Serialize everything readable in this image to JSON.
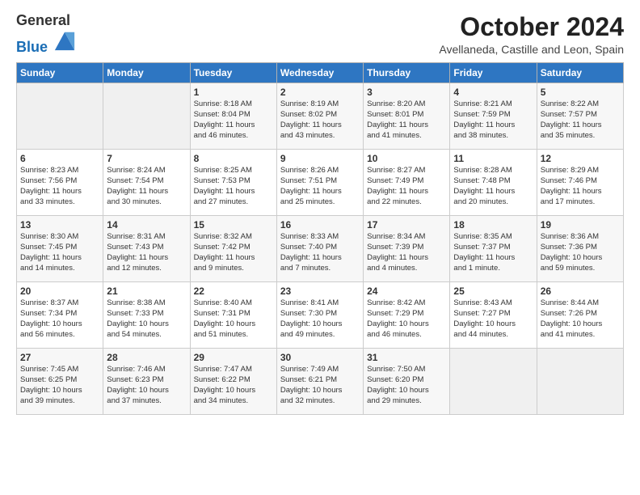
{
  "header": {
    "month_title": "October 2024",
    "subtitle": "Avellaneda, Castille and Leon, Spain",
    "logo_general": "General",
    "logo_blue": "Blue"
  },
  "calendar": {
    "headers": [
      "Sunday",
      "Monday",
      "Tuesday",
      "Wednesday",
      "Thursday",
      "Friday",
      "Saturday"
    ],
    "weeks": [
      [
        {
          "day": "",
          "detail": ""
        },
        {
          "day": "",
          "detail": ""
        },
        {
          "day": "1",
          "detail": "Sunrise: 8:18 AM\nSunset: 8:04 PM\nDaylight: 11 hours\nand 46 minutes."
        },
        {
          "day": "2",
          "detail": "Sunrise: 8:19 AM\nSunset: 8:02 PM\nDaylight: 11 hours\nand 43 minutes."
        },
        {
          "day": "3",
          "detail": "Sunrise: 8:20 AM\nSunset: 8:01 PM\nDaylight: 11 hours\nand 41 minutes."
        },
        {
          "day": "4",
          "detail": "Sunrise: 8:21 AM\nSunset: 7:59 PM\nDaylight: 11 hours\nand 38 minutes."
        },
        {
          "day": "5",
          "detail": "Sunrise: 8:22 AM\nSunset: 7:57 PM\nDaylight: 11 hours\nand 35 minutes."
        }
      ],
      [
        {
          "day": "6",
          "detail": "Sunrise: 8:23 AM\nSunset: 7:56 PM\nDaylight: 11 hours\nand 33 minutes."
        },
        {
          "day": "7",
          "detail": "Sunrise: 8:24 AM\nSunset: 7:54 PM\nDaylight: 11 hours\nand 30 minutes."
        },
        {
          "day": "8",
          "detail": "Sunrise: 8:25 AM\nSunset: 7:53 PM\nDaylight: 11 hours\nand 27 minutes."
        },
        {
          "day": "9",
          "detail": "Sunrise: 8:26 AM\nSunset: 7:51 PM\nDaylight: 11 hours\nand 25 minutes."
        },
        {
          "day": "10",
          "detail": "Sunrise: 8:27 AM\nSunset: 7:49 PM\nDaylight: 11 hours\nand 22 minutes."
        },
        {
          "day": "11",
          "detail": "Sunrise: 8:28 AM\nSunset: 7:48 PM\nDaylight: 11 hours\nand 20 minutes."
        },
        {
          "day": "12",
          "detail": "Sunrise: 8:29 AM\nSunset: 7:46 PM\nDaylight: 11 hours\nand 17 minutes."
        }
      ],
      [
        {
          "day": "13",
          "detail": "Sunrise: 8:30 AM\nSunset: 7:45 PM\nDaylight: 11 hours\nand 14 minutes."
        },
        {
          "day": "14",
          "detail": "Sunrise: 8:31 AM\nSunset: 7:43 PM\nDaylight: 11 hours\nand 12 minutes."
        },
        {
          "day": "15",
          "detail": "Sunrise: 8:32 AM\nSunset: 7:42 PM\nDaylight: 11 hours\nand 9 minutes."
        },
        {
          "day": "16",
          "detail": "Sunrise: 8:33 AM\nSunset: 7:40 PM\nDaylight: 11 hours\nand 7 minutes."
        },
        {
          "day": "17",
          "detail": "Sunrise: 8:34 AM\nSunset: 7:39 PM\nDaylight: 11 hours\nand 4 minutes."
        },
        {
          "day": "18",
          "detail": "Sunrise: 8:35 AM\nSunset: 7:37 PM\nDaylight: 11 hours\nand 1 minute."
        },
        {
          "day": "19",
          "detail": "Sunrise: 8:36 AM\nSunset: 7:36 PM\nDaylight: 10 hours\nand 59 minutes."
        }
      ],
      [
        {
          "day": "20",
          "detail": "Sunrise: 8:37 AM\nSunset: 7:34 PM\nDaylight: 10 hours\nand 56 minutes."
        },
        {
          "day": "21",
          "detail": "Sunrise: 8:38 AM\nSunset: 7:33 PM\nDaylight: 10 hours\nand 54 minutes."
        },
        {
          "day": "22",
          "detail": "Sunrise: 8:40 AM\nSunset: 7:31 PM\nDaylight: 10 hours\nand 51 minutes."
        },
        {
          "day": "23",
          "detail": "Sunrise: 8:41 AM\nSunset: 7:30 PM\nDaylight: 10 hours\nand 49 minutes."
        },
        {
          "day": "24",
          "detail": "Sunrise: 8:42 AM\nSunset: 7:29 PM\nDaylight: 10 hours\nand 46 minutes."
        },
        {
          "day": "25",
          "detail": "Sunrise: 8:43 AM\nSunset: 7:27 PM\nDaylight: 10 hours\nand 44 minutes."
        },
        {
          "day": "26",
          "detail": "Sunrise: 8:44 AM\nSunset: 7:26 PM\nDaylight: 10 hours\nand 41 minutes."
        }
      ],
      [
        {
          "day": "27",
          "detail": "Sunrise: 7:45 AM\nSunset: 6:25 PM\nDaylight: 10 hours\nand 39 minutes."
        },
        {
          "day": "28",
          "detail": "Sunrise: 7:46 AM\nSunset: 6:23 PM\nDaylight: 10 hours\nand 37 minutes."
        },
        {
          "day": "29",
          "detail": "Sunrise: 7:47 AM\nSunset: 6:22 PM\nDaylight: 10 hours\nand 34 minutes."
        },
        {
          "day": "30",
          "detail": "Sunrise: 7:49 AM\nSunset: 6:21 PM\nDaylight: 10 hours\nand 32 minutes."
        },
        {
          "day": "31",
          "detail": "Sunrise: 7:50 AM\nSunset: 6:20 PM\nDaylight: 10 hours\nand 29 minutes."
        },
        {
          "day": "",
          "detail": ""
        },
        {
          "day": "",
          "detail": ""
        }
      ]
    ]
  }
}
